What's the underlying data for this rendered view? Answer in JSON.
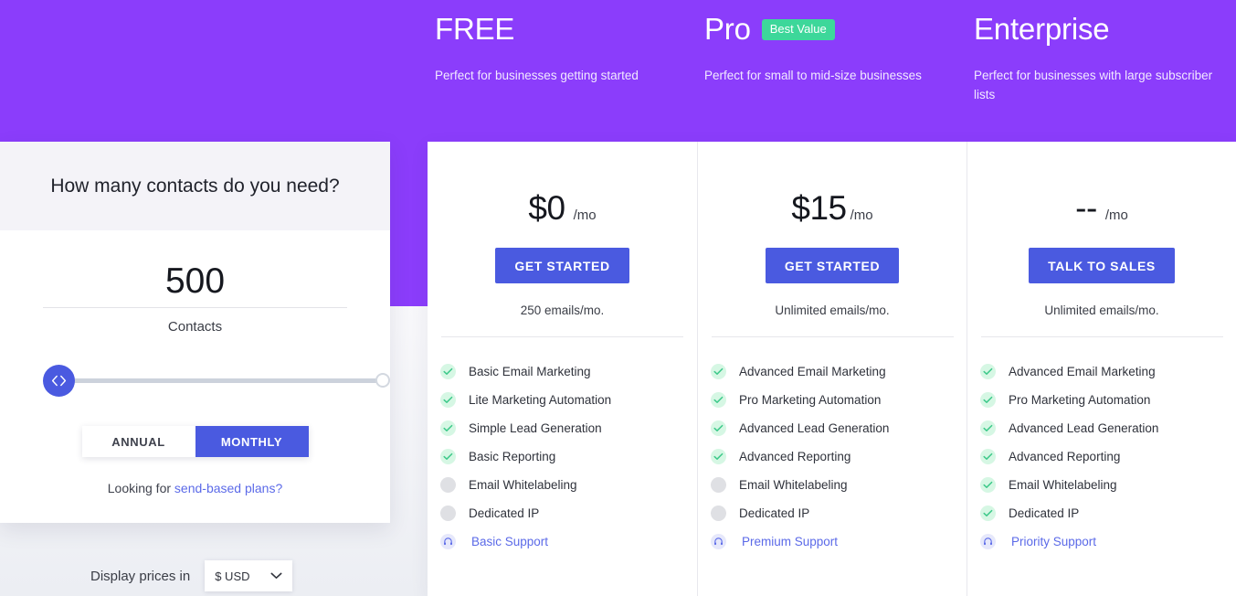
{
  "theme": {
    "hero_purple": "#8b3dfb",
    "accent_blue": "#4a5ae0",
    "badge_green": "#3dd79a",
    "check_green": "#3dc98a",
    "link_blue": "#5b6ae8"
  },
  "calculator": {
    "heading": "How many contacts do you need?",
    "count": "500",
    "unit": "Contacts",
    "slider": {
      "handle_icon": "chevron-left-right-icon",
      "value": 500,
      "position_percent": 0
    },
    "billing": {
      "options": [
        {
          "label": "ANNUAL",
          "active": false
        },
        {
          "label": "MONTHLY",
          "active": true
        }
      ]
    },
    "footnote_prefix": "Looking for ",
    "footnote_link": "send-based plans?"
  },
  "currency": {
    "label": "Display prices in",
    "selected": "$ USD",
    "chevron_icon": "chevron-down-icon"
  },
  "plans": [
    {
      "name": "FREE",
      "badge": null,
      "tagline": "Perfect for businesses getting started",
      "price": "$0",
      "per": "/mo",
      "cta": "GET STARTED",
      "emails": "250 emails/mo.",
      "features": [
        {
          "label": "Basic Email Marketing",
          "state": "on"
        },
        {
          "label": "Lite Marketing Automation",
          "state": "on"
        },
        {
          "label": "Simple Lead Generation",
          "state": "on"
        },
        {
          "label": "Basic Reporting",
          "state": "on"
        },
        {
          "label": "Email Whitelabeling",
          "state": "off"
        },
        {
          "label": "Dedicated IP",
          "state": "off"
        }
      ],
      "support": {
        "label": "Basic Support",
        "icon": "headset-icon"
      }
    },
    {
      "name": "Pro",
      "badge": "Best Value",
      "tagline": "Perfect for small to mid-size businesses",
      "price": "$15",
      "per": "/mo",
      "cta": "GET STARTED",
      "emails": "Unlimited emails/mo.",
      "features": [
        {
          "label": "Advanced Email Marketing",
          "state": "on"
        },
        {
          "label": "Pro Marketing Automation",
          "state": "on"
        },
        {
          "label": "Advanced Lead Generation",
          "state": "on"
        },
        {
          "label": "Advanced Reporting",
          "state": "on"
        },
        {
          "label": "Email Whitelabeling",
          "state": "off"
        },
        {
          "label": "Dedicated IP",
          "state": "off"
        }
      ],
      "support": {
        "label": "Premium Support",
        "icon": "headset-icon"
      }
    },
    {
      "name": "Enterprise",
      "badge": null,
      "tagline": "Perfect for businesses with large subscriber lists",
      "price": "--",
      "per": "/mo",
      "cta": "TALK TO SALES",
      "emails": "Unlimited emails/mo.",
      "features": [
        {
          "label": "Advanced Email Marketing",
          "state": "on"
        },
        {
          "label": "Pro Marketing Automation",
          "state": "on"
        },
        {
          "label": "Advanced Lead Generation",
          "state": "on"
        },
        {
          "label": "Advanced Reporting",
          "state": "on"
        },
        {
          "label": "Email Whitelabeling",
          "state": "on"
        },
        {
          "label": "Dedicated IP",
          "state": "on"
        }
      ],
      "support": {
        "label": "Priority Support",
        "icon": "headset-icon"
      }
    }
  ]
}
